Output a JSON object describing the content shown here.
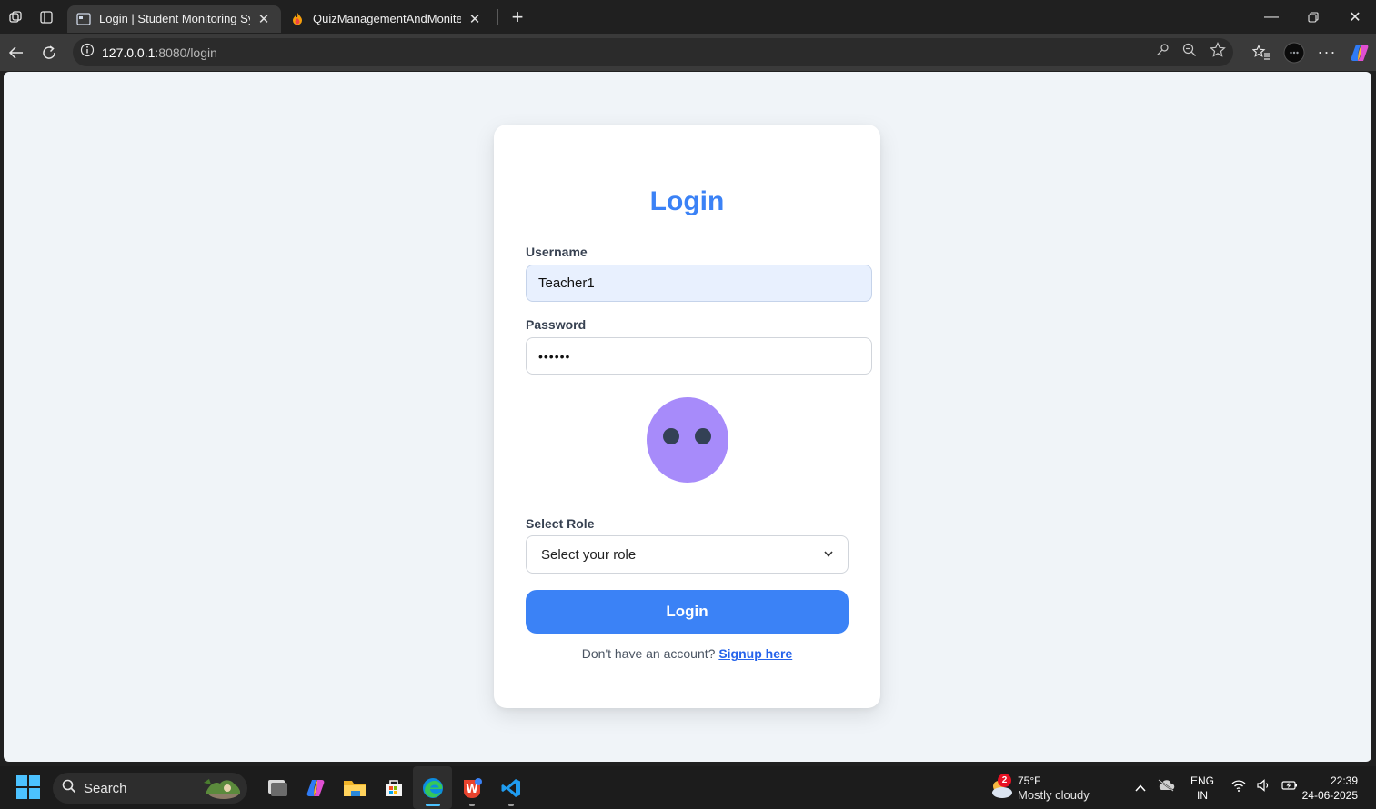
{
  "browser": {
    "tabs": [
      {
        "title": "Login | Student Monitoring System",
        "active": true
      },
      {
        "title": "QuizManagementAndMonitering",
        "active": false
      }
    ],
    "url_host": "127.0.0.1",
    "url_path": ":8080/login"
  },
  "login_form": {
    "heading": "Login",
    "username_label": "Username",
    "username_value": "Teacher1",
    "password_label": "Password",
    "password_value": "••••••",
    "role_label": "Select Role",
    "role_selected": "Select your role",
    "submit_label": "Login",
    "signup_prompt": "Don't have an account?",
    "signup_link": "Signup here"
  },
  "taskbar": {
    "search_label": "Search",
    "weather_badge": "2",
    "weather_temp": "75°F",
    "weather_condition": "Mostly cloudy",
    "lang_primary": "ENG",
    "lang_secondary": "IN",
    "time": "22:39",
    "date": "24-06-2025"
  },
  "colors": {
    "accent": "#3b82f6",
    "mascot": "#a78bfa",
    "page_bg": "#f0f4f8"
  },
  "icons": [
    "workspaces-icon",
    "tab-actions-icon",
    "page-favicon-icon",
    "fire-favicon-icon",
    "back-icon",
    "refresh-icon",
    "info-icon",
    "key-icon",
    "zoom-icon",
    "star-icon",
    "favorites-icon",
    "profile-icon",
    "more-icon",
    "copilot-icon"
  ]
}
